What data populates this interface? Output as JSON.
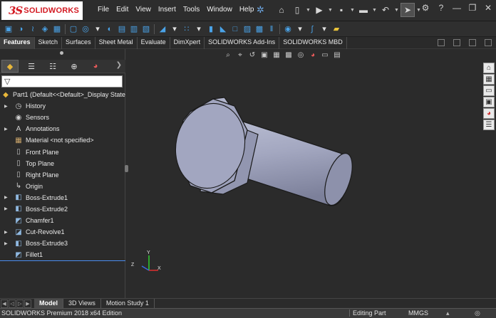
{
  "app": {
    "logo_mark": "3S",
    "logo_word": "SOLIDWORKS"
  },
  "menu": [
    "File",
    "Edit",
    "View",
    "Insert",
    "Tools",
    "Window",
    "Help"
  ],
  "quick_access": [
    {
      "name": "home-icon",
      "glyph": "⌂"
    },
    {
      "name": "new-document-icon",
      "glyph": "▯"
    },
    {
      "name": "open-icon",
      "glyph": "▶"
    },
    {
      "name": "save-icon",
      "glyph": "▪"
    },
    {
      "name": "print-icon",
      "glyph": "▬"
    },
    {
      "name": "undo-icon",
      "glyph": "↶"
    },
    {
      "name": "select-icon",
      "glyph": "➤"
    },
    {
      "name": "options-icon",
      "glyph": "⚙"
    },
    {
      "name": "help-icon",
      "glyph": "?"
    }
  ],
  "tabs": {
    "items": [
      "Features",
      "Sketch",
      "Surfaces",
      "Sheet Metal",
      "Evaluate",
      "DimXpert",
      "SOLIDWORKS Add-Ins",
      "SOLIDWORKS MBD"
    ],
    "active": "Features"
  },
  "tree": [
    {
      "label": "Part1  (Default<<Default>_Display State",
      "icon": "part-icon",
      "glyph": "◆",
      "color": "#e8b73a",
      "expand": false,
      "root": true
    },
    {
      "label": "History",
      "icon": "history-icon",
      "glyph": "◷",
      "color": "#d0d0d0",
      "expand": true
    },
    {
      "label": "Sensors",
      "icon": "sensors-icon",
      "glyph": "◉",
      "color": "#d0d0d0",
      "expand": false
    },
    {
      "label": "Annotations",
      "icon": "annotations-icon",
      "glyph": "A",
      "color": "#d0d0d0",
      "expand": true
    },
    {
      "label": "Material <not specified>",
      "icon": "material-icon",
      "glyph": "▦",
      "color": "#c9a46a",
      "expand": false
    },
    {
      "label": "Front Plane",
      "icon": "plane-icon",
      "glyph": "▯",
      "color": "#bfbfbf",
      "expand": false
    },
    {
      "label": "Top Plane",
      "icon": "plane-icon",
      "glyph": "▯",
      "color": "#bfbfbf",
      "expand": false
    },
    {
      "label": "Right Plane",
      "icon": "plane-icon",
      "glyph": "▯",
      "color": "#bfbfbf",
      "expand": false
    },
    {
      "label": "Origin",
      "icon": "origin-icon",
      "glyph": "↳",
      "color": "#d0d0d0",
      "expand": false
    },
    {
      "label": "Boss-Extrude1",
      "icon": "extrude-icon",
      "glyph": "◧",
      "color": "#8fb8e0",
      "expand": true
    },
    {
      "label": "Boss-Extrude2",
      "icon": "extrude-icon",
      "glyph": "◧",
      "color": "#8fb8e0",
      "expand": true
    },
    {
      "label": "Chamfer1",
      "icon": "chamfer-icon",
      "glyph": "◩",
      "color": "#8fb8e0",
      "expand": false
    },
    {
      "label": "Cut-Revolve1",
      "icon": "revolve-cut-icon",
      "glyph": "◪",
      "color": "#8fb8e0",
      "expand": true
    },
    {
      "label": "Boss-Extrude3",
      "icon": "extrude-icon",
      "glyph": "◧",
      "color": "#8fb8e0",
      "expand": true
    },
    {
      "label": "Fillet1",
      "icon": "fillet-icon",
      "glyph": "◩",
      "color": "#8fb8e0",
      "expand": false
    }
  ],
  "bottom_tabs": {
    "items": [
      "Model",
      "3D Views",
      "Motion Study 1"
    ],
    "active": "Model"
  },
  "triad": {
    "x": "X",
    "y": "Y",
    "z": "Z"
  },
  "status": {
    "edition": "SOLIDWORKS Premium 2018 x64 Edition",
    "mode": "Editing Part",
    "units": "MMGS"
  },
  "colors": {
    "background": "#2b2b2b",
    "accent": "#4aa3e8",
    "model_face": "#a9adc6",
    "brand": "#d41a22"
  }
}
